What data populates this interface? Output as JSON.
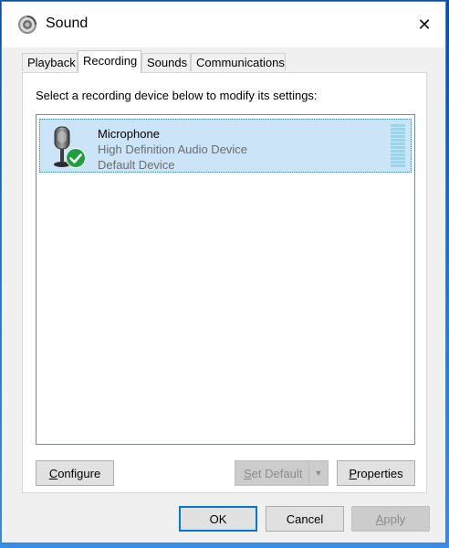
{
  "window": {
    "title": "Sound",
    "icon": "speaker-icon",
    "close_glyph": "✕"
  },
  "tabs": [
    {
      "label": "Playback",
      "active": false
    },
    {
      "label": "Recording",
      "active": true
    },
    {
      "label": "Sounds",
      "active": false
    },
    {
      "label": "Communications",
      "active": false
    }
  ],
  "panel": {
    "instruction": "Select a recording device below to modify its settings:"
  },
  "devices": [
    {
      "name": "Microphone",
      "description": "High Definition Audio Device",
      "status": "Default Device",
      "icon": "microphone-icon",
      "badge": "default-check-icon",
      "selected": true
    }
  ],
  "buttons": {
    "configure": {
      "prefix": "",
      "accel": "C",
      "rest": "onfigure"
    },
    "set_default": {
      "prefix": "",
      "accel": "S",
      "rest": "et Default"
    },
    "properties": {
      "prefix": "",
      "accel": "P",
      "rest": "roperties"
    },
    "ok": "OK",
    "cancel": "Cancel",
    "apply": {
      "prefix": "",
      "accel": "A",
      "rest": "pply"
    }
  },
  "colors": {
    "selection": "#cce4f7",
    "accent": "#0078d7",
    "check_badge": "#1e9e3e"
  }
}
